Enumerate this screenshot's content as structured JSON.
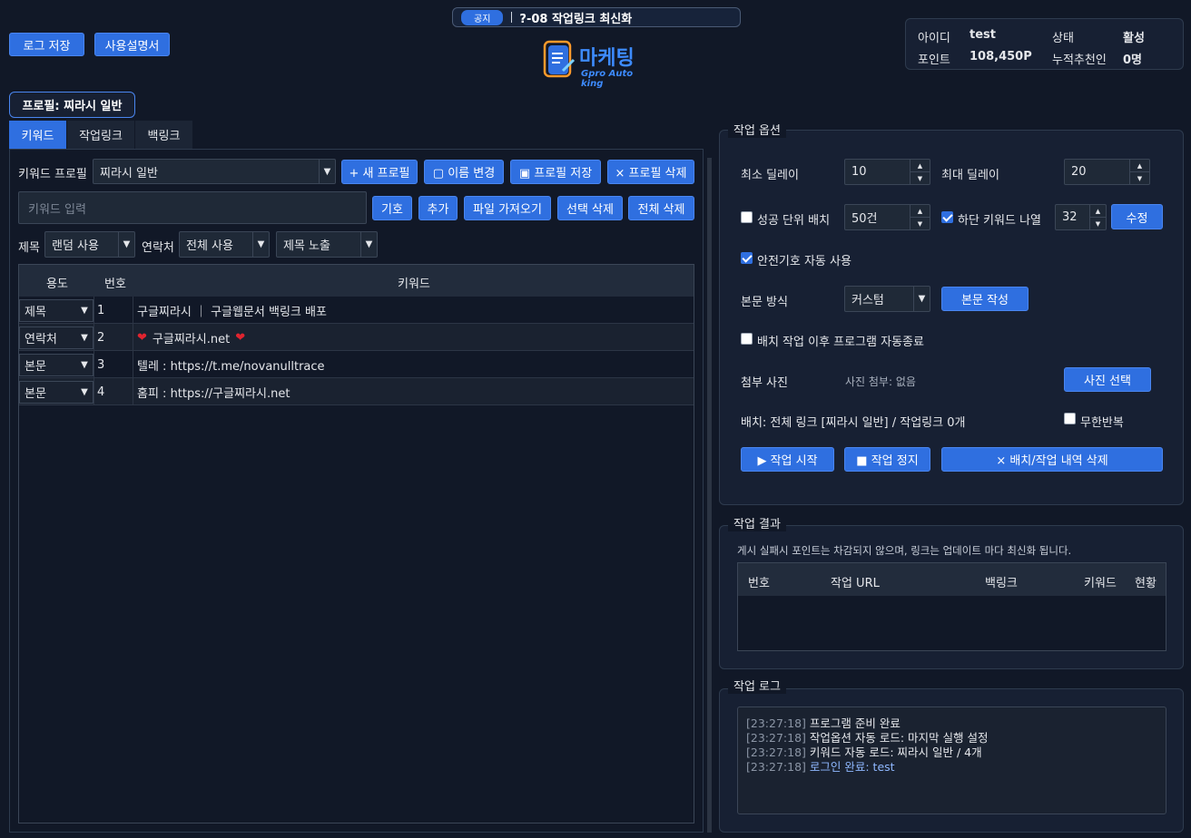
{
  "notice": {
    "badge": "공지",
    "text": "?-08 작업링크 최신화"
  },
  "top_buttons": {
    "log_save": "로그 저장",
    "manual": "사용설명서"
  },
  "logo": {
    "main": "마케팅",
    "sub": "Gpro Auto king"
  },
  "account": {
    "id_label": "아이디",
    "id_value": "test",
    "status_label": "상태",
    "status_value": "활성",
    "points_label": "포인트",
    "points_value": "108,450P",
    "referral_label": "누적추천인",
    "referral_value": "0명"
  },
  "profile_badge": "프로필: 찌라시 일반",
  "tabs": [
    "키워드",
    "작업링크",
    "백링크"
  ],
  "keyword_panel": {
    "profile_label": "키워드 프로필",
    "profile_value": "찌라시 일반",
    "new_profile": "+ 새 프로필",
    "rename": "▢ 이름 변경",
    "save_profile": "▣ 프로필 저장",
    "delete_profile": "× 프로필 삭제",
    "keyword_placeholder": "키워드 입력",
    "symbol": "기호",
    "add": "추가",
    "import_file": "파일 가져오기",
    "delete_selected": "선택 삭제",
    "delete_all": "전체 삭제",
    "title_label": "제목",
    "title_value": "랜덤 사용",
    "contact_label": "연락처",
    "contact_value": "전체 사용",
    "title_expose_value": "제목 노출"
  },
  "keyword_table": {
    "headers": [
      "용도",
      "번호",
      "키워드"
    ],
    "rows": [
      {
        "usage": "제목",
        "num": "1",
        "keyword": "구글찌라시 ｜ 구글웹문서 백링크 배포"
      },
      {
        "usage": "연락처",
        "num": "2",
        "keyword": "구글찌라시.net",
        "hearts": true
      },
      {
        "usage": "본문",
        "num": "3",
        "keyword": "텔레 : https://t.me/novanulltrace"
      },
      {
        "usage": "본문",
        "num": "4",
        "keyword": "홈피 : https://구글찌라시.net"
      }
    ]
  },
  "options": {
    "title": "작업 옵션",
    "min_delay_label": "최소 딜레이",
    "min_delay": "10",
    "max_delay_label": "최대 딜레이",
    "max_delay": "20",
    "batch_label": "성공 단위 배치",
    "batch_value": "50건",
    "bottom_kw_label": "하단 키워드 나열",
    "bottom_kw_value": "32",
    "edit": "수정",
    "safe_symbol_label": "안전기호 자동 사용",
    "body_mode_label": "본문 방식",
    "body_mode_value": "커스텀",
    "write_body": "본문 작성",
    "auto_exit_label": "배치 작업 이후 프로그램 자동종료",
    "photo_label": "첨부 사진",
    "photo_status": "사진 첨부: 없음",
    "photo_select": "사진 선택",
    "batch_info": "배치: 전체 링크 [찌라시 일반] / 작업링크 0개",
    "infinite_label": "무한반복",
    "start": "▶ 작업 시작",
    "stop": "■ 작업 정지",
    "clear": "× 배치/작업 내역 삭제"
  },
  "results": {
    "title": "작업 결과",
    "note": "게시 실패시 포인트는 차감되지 않으며, 링크는 업데이트 마다 최신화 됩니다.",
    "headers": [
      "번호",
      "작업 URL",
      "백링크",
      "키워드",
      "현황"
    ]
  },
  "log": {
    "title": "작업 로그",
    "lines": [
      {
        "time": "[23:27:18]",
        "msg": "프로그램 준비 완료",
        "color": "#e5e7eb"
      },
      {
        "time": "[23:27:18]",
        "msg": "작업옵션 자동 로드: 마지막 실행 설정",
        "color": "#e5e7eb"
      },
      {
        "time": "[23:27:18]",
        "msg": "키워드 자동 로드: 찌라시 일반 / 4개",
        "color": "#e5e7eb"
      },
      {
        "time": "[23:27:18]",
        "msg": "로그인 완료: test",
        "color": "#8fb8ff"
      }
    ]
  },
  "colors": {
    "accent": "#2f6fe0",
    "background": "#111827",
    "heart": "#e0242f"
  }
}
